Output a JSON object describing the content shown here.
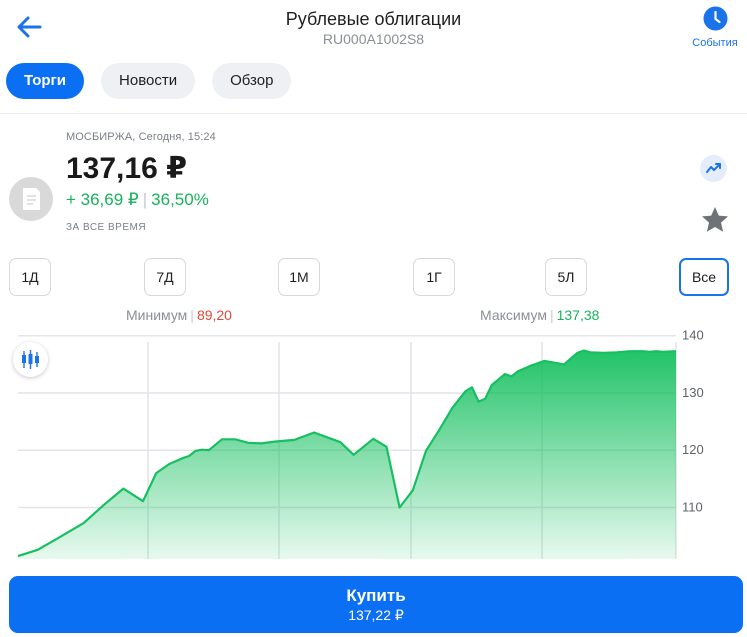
{
  "header": {
    "title": "Рублевые облигации",
    "subtitle": "RU000A1002S8",
    "events_label": "События",
    "back_icon": "arrow-left-icon",
    "events_icon": "clock-icon"
  },
  "tabs": [
    {
      "label": "Торги",
      "active": true
    },
    {
      "label": "Новости",
      "active": false
    },
    {
      "label": "Обзор",
      "active": false
    }
  ],
  "quote": {
    "meta": "МОСБИРЖА, Сегодня, 15:24",
    "price": "137,16 ₽",
    "change_abs": "+ 36,69 ₽",
    "change_pct": "36,50%",
    "period_label": "ЗА ВСЕ ВРЕМЯ"
  },
  "ranges": [
    {
      "label": "1Д",
      "active": false
    },
    {
      "label": "7Д",
      "active": false
    },
    {
      "label": "1М",
      "active": false
    },
    {
      "label": "1Г",
      "active": false
    },
    {
      "label": "5Л",
      "active": false
    },
    {
      "label": "Все",
      "active": true
    }
  ],
  "minmax": {
    "min_label": "Минимум",
    "min_value": "89,20",
    "max_label": "Максимум",
    "max_value": "137,38"
  },
  "chart_data": {
    "type": "area",
    "x": [
      0,
      0.03,
      0.06,
      0.1,
      0.13,
      0.16,
      0.19,
      0.21,
      0.23,
      0.25,
      0.26,
      0.27,
      0.28,
      0.29,
      0.31,
      0.33,
      0.35,
      0.37,
      0.39,
      0.42,
      0.45,
      0.49,
      0.51,
      0.54,
      0.56,
      0.58,
      0.6,
      0.62,
      0.64,
      0.66,
      0.68,
      0.69,
      0.7,
      0.71,
      0.72,
      0.74,
      0.75,
      0.76,
      0.78,
      0.8,
      0.81,
      0.83,
      0.84,
      0.85,
      0.86,
      0.87,
      0.89,
      0.91,
      0.93,
      0.95,
      0.96,
      0.97,
      0.98,
      1
    ],
    "y": [
      101.5,
      102.6,
      104.6,
      107.3,
      110.4,
      113.3,
      111.1,
      116.0,
      117.6,
      118.6,
      119.0,
      119.9,
      120.1,
      120.0,
      121.9,
      121.9,
      121.3,
      121.2,
      121.5,
      121.8,
      123.1,
      121.4,
      119.2,
      122.0,
      120.6,
      110.0,
      113.0,
      119.9,
      123.5,
      127.4,
      130.3,
      131.0,
      128.5,
      129.0,
      131.4,
      133.3,
      132.9,
      133.8,
      134.8,
      135.6,
      135.4,
      135.0,
      136.0,
      137.0,
      137.4,
      137.1,
      137.0,
      137.1,
      137.3,
      137.3,
      137.2,
      137.3,
      137.2,
      137.3
    ],
    "ylim": [
      101,
      141
    ],
    "yticks": [
      110,
      120,
      130,
      140
    ],
    "grid": true,
    "color": "#16c060"
  },
  "buy": {
    "label": "Купить",
    "price": "137,22 ₽"
  },
  "colors": {
    "accent": "#0a6ff2",
    "positive": "#16b35a",
    "negative": "#e0483c"
  }
}
